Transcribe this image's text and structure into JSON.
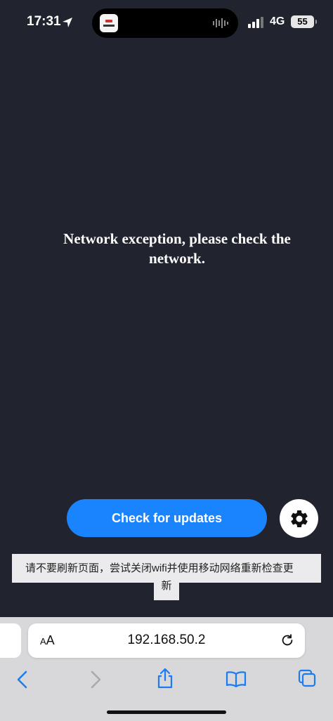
{
  "status_bar": {
    "time": "17:31",
    "network": "4G",
    "battery": "55"
  },
  "page": {
    "message": "Network exception, please check the network."
  },
  "actions": {
    "check_updates_label": "Check for updates",
    "settings_icon": "gear-icon"
  },
  "notice": {
    "line1": "请不要刷新页面，尝试关闭wifi并使用移动网络重新检查更",
    "line2": "新"
  },
  "browser": {
    "text_size_label": "AA",
    "url": "192.168.50.2",
    "toolbar_icons": [
      "back-icon",
      "forward-icon",
      "share-icon",
      "bookmarks-icon",
      "tabs-icon"
    ]
  },
  "colors": {
    "background": "#21232e",
    "accent": "#1a84ff"
  }
}
